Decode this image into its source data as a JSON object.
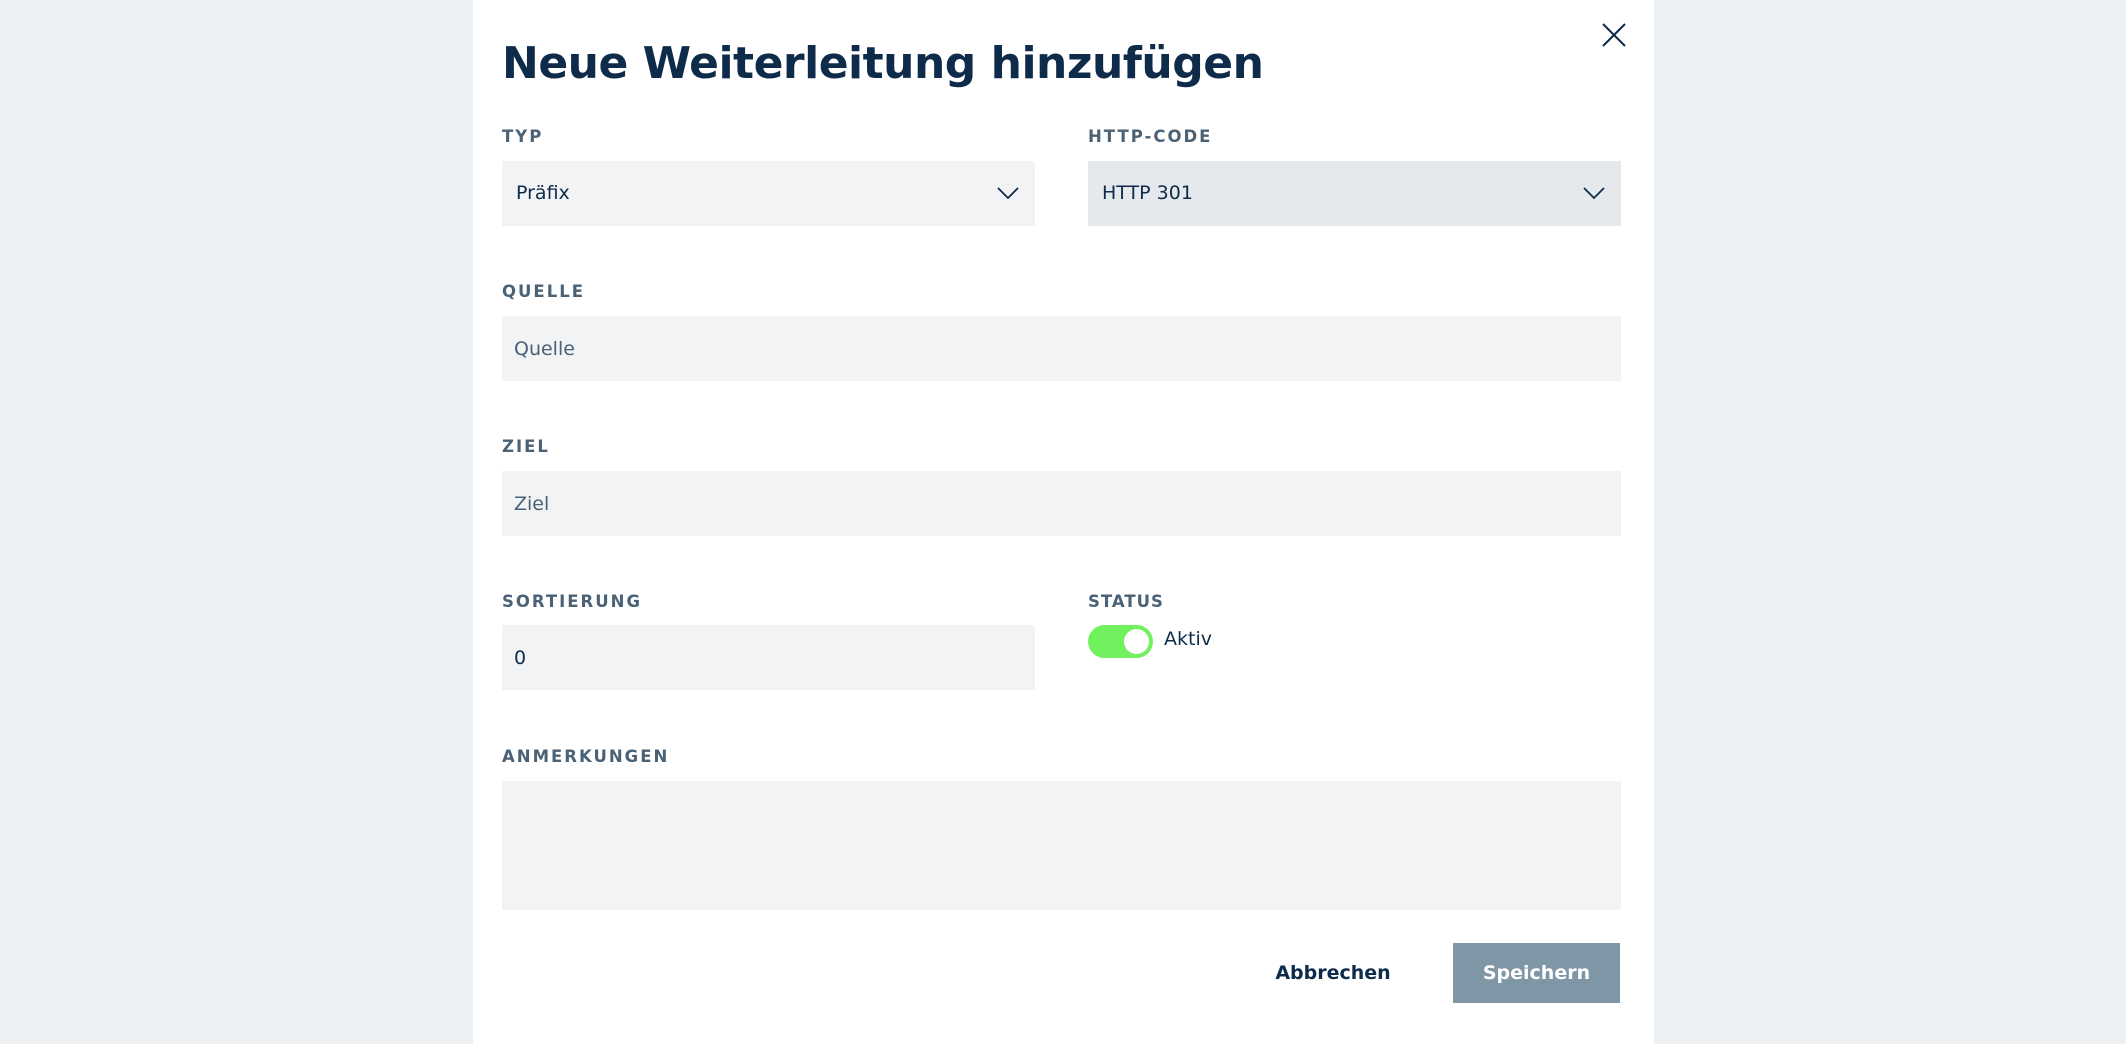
{
  "dialog": {
    "title": "Neue Weiterleitung hinzufügen",
    "close_icon": "close-icon"
  },
  "fields": {
    "typ": {
      "label": "TYP",
      "value": "Präfix"
    },
    "http_code": {
      "label": "HTTP-CODE",
      "value": "HTTP 301"
    },
    "quelle": {
      "label": "QUELLE",
      "placeholder": "Quelle",
      "value": ""
    },
    "ziel": {
      "label": "ZIEL",
      "placeholder": "Ziel",
      "value": ""
    },
    "sortierung": {
      "label": "SORTIERUNG",
      "value": "0"
    },
    "status": {
      "label": "STATUS",
      "toggle_label": "Aktiv",
      "enabled": true
    },
    "anmerkungen": {
      "label": "ANMERKUNGEN",
      "value": ""
    }
  },
  "actions": {
    "cancel_label": "Abbrechen",
    "save_label": "Speichern"
  },
  "colors": {
    "background": "#edf0f3",
    "panel": "#ffffff",
    "text_dark": "#0f2b4a",
    "label": "#4b6176",
    "field_bg": "#f1f3f5",
    "toggle_on": "#72f15e",
    "save_button": "#7f96a6"
  }
}
